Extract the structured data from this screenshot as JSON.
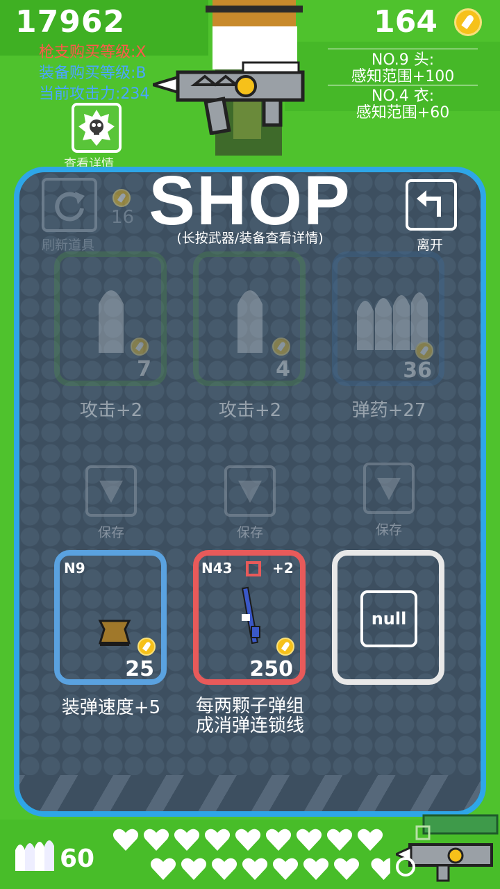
{
  "hud": {
    "score": "17962",
    "gun_level": "枪支购买等级:X",
    "gear_level": "装备购买等级:B",
    "attack": "当前攻击力:234",
    "coins": "164",
    "equip1_title": "NO.9 头:",
    "equip1_value": "感知范围+100",
    "equip2_title": "NO.4 衣:",
    "equip2_value": "感知范围+60",
    "detail_label": "查看详情",
    "ammo_count": "60",
    "hearts_row1": 9,
    "hearts_row2": 7.5
  },
  "shop": {
    "title": "SHOP",
    "subtitle": "(长按武器/装备查看详情)",
    "refresh_label": "刷新道具",
    "refresh_cost": "16",
    "leave_label": "离开",
    "upgrades": [
      {
        "icon": "bullet-icon",
        "price": "7",
        "label": "攻击+2",
        "color": "#4c8b4a"
      },
      {
        "icon": "bullet-icon",
        "price": "4",
        "label": "攻击+2",
        "color": "#4c8b4a"
      },
      {
        "icon": "ammo-pack-icon",
        "price": "36",
        "label": "弹药+27",
        "color": "#3d6a98"
      }
    ],
    "save_label": "保存",
    "items": [
      {
        "code": "N9",
        "price": "25",
        "desc_line1": "装弹速度+5",
        "desc_line2": "",
        "color": "#5aa2e0",
        "icon": "box-icon"
      },
      {
        "code": "N43",
        "extra": "+2",
        "price": "250",
        "desc_line1": "每两颗子弹组",
        "desc_line2": "成消弹连锁线",
        "color": "#e85a5a",
        "icon": "rifle-icon"
      },
      {
        "code": "",
        "price": "",
        "desc_line1": "",
        "desc_line2": "",
        "color": "#e8e8e8",
        "icon": "null-icon",
        "null_text": "null"
      }
    ]
  },
  "colors": {
    "gun_level": "#ff5a4a",
    "gear_level": "#4aa6ff",
    "attack": "#4aa6ff",
    "panel_border": "#2ea6e8",
    "coin": "#f6c11a"
  }
}
